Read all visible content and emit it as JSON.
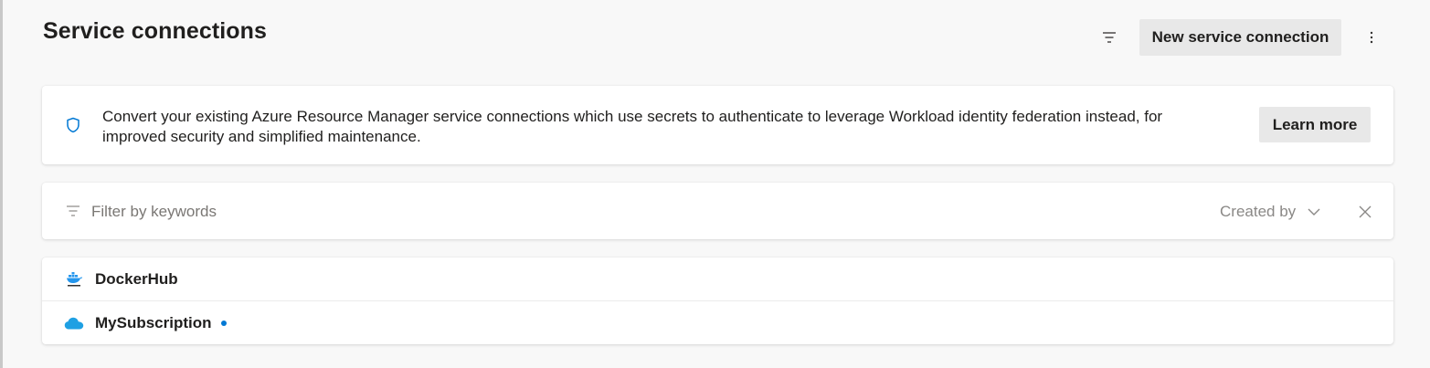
{
  "header": {
    "title": "Service connections",
    "new_button_label": "New service connection",
    "filter_icon": "filter-icon",
    "more_icon": "more-vertical-icon"
  },
  "banner": {
    "icon": "shield-icon",
    "text": "Convert your existing Azure Resource Manager service connections which use secrets to authenticate to leverage Workload identity federation instead, for improved security and simplified maintenance.",
    "learn_more_label": "Learn more"
  },
  "filter": {
    "placeholder": "Filter by keywords",
    "value": "",
    "created_by_label": "Created by",
    "dropdown_icon": "chevron-down-icon",
    "clear_icon": "close-icon"
  },
  "connections": [
    {
      "name": "DockerHub",
      "icon": "docker-icon"
    },
    {
      "name": "MySubscription",
      "icon": "azure-cloud-icon",
      "has_status_dot": true
    }
  ],
  "colors": {
    "accent": "#0078d4",
    "azure_cloud": "#1fa0e3",
    "docker": "#2496ed",
    "background": "#f8f8f8",
    "card": "#ffffff",
    "button": "#e8e8e8"
  }
}
